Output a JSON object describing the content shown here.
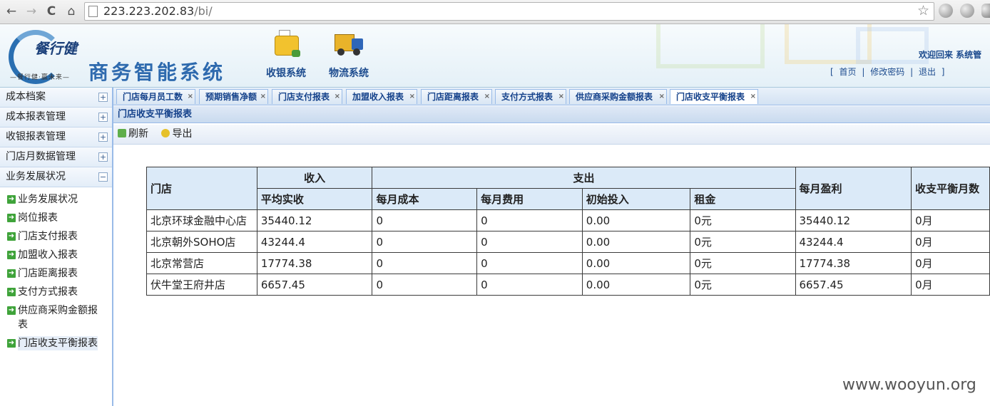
{
  "browser": {
    "url_host": "223.223.202.83",
    "url_path": "/bi/",
    "back": "←",
    "forward": "→",
    "reload": "C",
    "home": "⌂",
    "star": "☆"
  },
  "header": {
    "logo_text": "餐行健",
    "logo_sub": "—餐行健·赢未来—",
    "system_title": "商务智能系统",
    "modules": [
      {
        "label": "收银系统",
        "icon": "cash-register-icon"
      },
      {
        "label": "物流系统",
        "icon": "truck-icon"
      }
    ],
    "welcome": "欢迎回来  系统管",
    "links": {
      "open": "[",
      "home": "首页",
      "sep": "|",
      "change_password": "修改密码",
      "logout": "退出",
      "close": "]"
    }
  },
  "sidebar": {
    "sections": [
      {
        "label": "成本档案",
        "toggle": "+"
      },
      {
        "label": "成本报表管理",
        "toggle": "+"
      },
      {
        "label": "收银报表管理",
        "toggle": "+"
      },
      {
        "label": "门店月数据管理",
        "toggle": "+"
      },
      {
        "label": "业务发展状况",
        "toggle": "−"
      }
    ],
    "items": [
      "业务发展状况",
      "岗位报表",
      "门店支付报表",
      "加盟收入报表",
      "门店距离报表",
      "支付方式报表",
      "供应商采购金额报表",
      "门店收支平衡报表"
    ]
  },
  "tabs": [
    "门店每月员工数",
    "预期销售净额",
    "门店支付报表",
    "加盟收入报表",
    "门店距离报表",
    "支付方式报表",
    "供应商采购金额报表",
    "门店收支平衡报表"
  ],
  "tab_close": "×",
  "panel": {
    "title": "门店收支平衡报表",
    "refresh": "刷新",
    "export": "导出"
  },
  "table": {
    "headers": {
      "store": "门店",
      "income": "收入",
      "expense": "支出",
      "avg_income": "平均实收",
      "monthly_cost": "每月成本",
      "monthly_fee": "每月费用",
      "initial_investment": "初始投入",
      "rent": "租金",
      "monthly_profit": "每月盈利",
      "break_even_months": "收支平衡月数"
    },
    "rows": [
      [
        "北京环球金融中心店",
        "35440.12",
        "0",
        "0",
        "0.00",
        "0元",
        "35440.12",
        "0月"
      ],
      [
        "北京朝外SOHO店",
        "43244.4",
        "0",
        "0",
        "0.00",
        "0元",
        "43244.4",
        "0月"
      ],
      [
        "北京常营店",
        "17774.38",
        "0",
        "0",
        "0.00",
        "0元",
        "17774.38",
        "0月"
      ],
      [
        "伏牛堂王府井店",
        "6657.45",
        "0",
        "0",
        "0.00",
        "0元",
        "6657.45",
        "0月"
      ]
    ]
  },
  "watermark": "www.wooyun.org"
}
